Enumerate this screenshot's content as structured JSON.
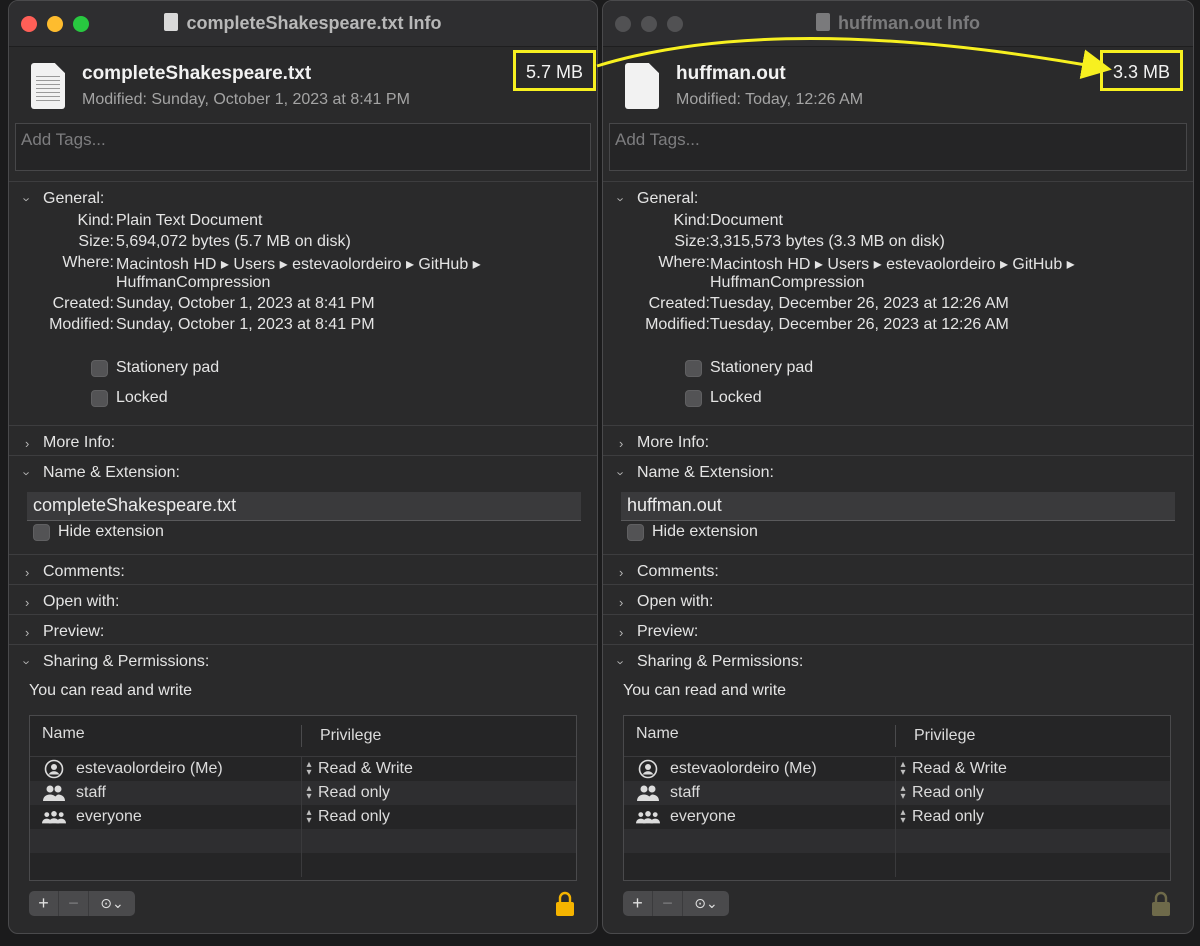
{
  "windows": [
    {
      "id": "left",
      "title": "completeShakespeare.txt Info",
      "active": true,
      "file_name": "completeShakespeare.txt",
      "modified_line": "Modified: Sunday, October 1, 2023 at 8:41 PM",
      "size_badge": "5.7 MB",
      "tags_placeholder": "Add Tags...",
      "general": {
        "heading": "General:",
        "kind_label": "Kind:",
        "kind": "Plain Text Document",
        "size_label": "Size:",
        "size": "5,694,072 bytes (5.7 MB on disk)",
        "where_label": "Where:",
        "where_line1": "Macintosh HD ▸ Users ▸ estevaolordeiro ▸ GitHub ▸",
        "where_line2": "HuffmanCompression",
        "created_label": "Created:",
        "created": "Sunday, October 1, 2023 at 8:41 PM",
        "modified_label": "Modified:",
        "modified": "Sunday, October 1, 2023 at 8:41 PM",
        "stationery": "Stationery pad",
        "locked": "Locked"
      },
      "more_info": "More Info:",
      "name_ext": {
        "heading": "Name & Extension:",
        "value": "completeShakespeare.txt",
        "hide_ext": "Hide extension"
      },
      "comments": "Comments:",
      "open_with": "Open with:",
      "preview": "Preview:",
      "sharing": {
        "heading": "Sharing & Permissions:",
        "summary": "You can read and write",
        "col_name": "Name",
        "col_priv": "Privilege",
        "rows": [
          {
            "name": "estevaolordeiro (Me)",
            "priv": "Read & Write",
            "icon": "user-icon"
          },
          {
            "name": "staff",
            "priv": "Read only",
            "icon": "group-icon"
          },
          {
            "name": "everyone",
            "priv": "Read only",
            "icon": "everyone-icon"
          }
        ]
      },
      "buttons": {
        "add": "+",
        "remove": "−",
        "action": "⊙⌄"
      },
      "lock_color": "#f5b400"
    },
    {
      "id": "right",
      "title": "huffman.out Info",
      "active": false,
      "file_name": "huffman.out",
      "modified_line": "Modified: Today, 12:26 AM",
      "size_badge": "3.3 MB",
      "tags_placeholder": "Add Tags...",
      "general": {
        "heading": "General:",
        "kind_label": "Kind:",
        "kind": "Document",
        "size_label": "Size:",
        "size": "3,315,573 bytes (3.3 MB on disk)",
        "where_label": "Where:",
        "where_line1": "Macintosh HD ▸ Users ▸ estevaolordeiro ▸ GitHub ▸",
        "where_line2": "HuffmanCompression",
        "created_label": "Created:",
        "created": "Tuesday, December 26, 2023 at 12:26 AM",
        "modified_label": "Modified:",
        "modified": "Tuesday, December 26, 2023 at 12:26 AM",
        "stationery": "Stationery pad",
        "locked": "Locked"
      },
      "more_info": "More Info:",
      "name_ext": {
        "heading": "Name & Extension:",
        "value": "huffman.out",
        "hide_ext": "Hide extension"
      },
      "comments": "Comments:",
      "open_with": "Open with:",
      "preview": "Preview:",
      "sharing": {
        "heading": "Sharing & Permissions:",
        "summary": "You can read and write",
        "col_name": "Name",
        "col_priv": "Privilege",
        "rows": [
          {
            "name": "estevaolordeiro (Me)",
            "priv": "Read & Write",
            "icon": "user-icon"
          },
          {
            "name": "staff",
            "priv": "Read only",
            "icon": "group-icon"
          },
          {
            "name": "everyone",
            "priv": "Read only",
            "icon": "everyone-icon"
          }
        ]
      },
      "buttons": {
        "add": "+",
        "remove": "−",
        "action": "⊙⌄"
      },
      "lock_color": "#6e6a4a"
    }
  ],
  "annotation": {
    "color": "#f7f020"
  }
}
